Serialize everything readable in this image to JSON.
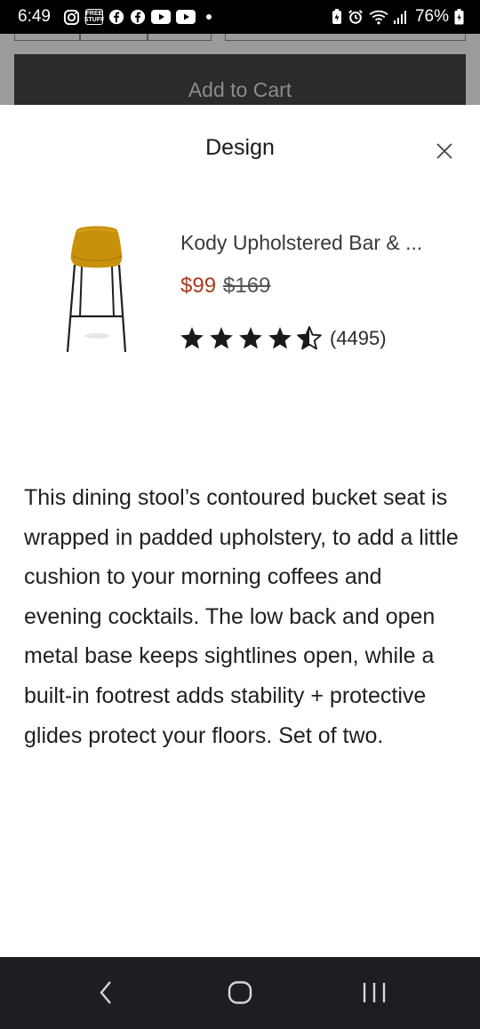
{
  "status_bar": {
    "time": "6:49",
    "free_stuff_badge": "FREE STUFF",
    "battery_percent": "76%",
    "icons": [
      "instagram-icon",
      "free-stuff-icon",
      "facebook-icon",
      "facebook-icon",
      "youtube-icon",
      "youtube-icon",
      "notification-dot",
      "battery-saver-icon",
      "alarm-icon",
      "wifi-icon",
      "signal-icon",
      "battery-icon"
    ]
  },
  "background_page": {
    "add_to_cart_label": "Add to Cart"
  },
  "sheet": {
    "title": "Design",
    "close_icon": "close-icon",
    "product": {
      "name": "Kody Upholstered Bar & ...",
      "sale_price": "$99",
      "original_price": "$169",
      "rating": 4.5,
      "rating_max": 5,
      "review_count": "(4495)",
      "sale_color": "#a8391b",
      "seat_color": "#c8900b"
    },
    "description": "This dining stool’s contoured bucket seat is wrapped in padded upholstery, to add a little cushion to your morning coffees and evening cocktails. The low back and open metal base keeps sightlines open, while a built-in footrest adds stability + protective glides protect your floors. Set of two."
  },
  "nav_bar": {
    "icons": [
      "back-icon",
      "home-icon",
      "recent-apps-icon"
    ]
  }
}
